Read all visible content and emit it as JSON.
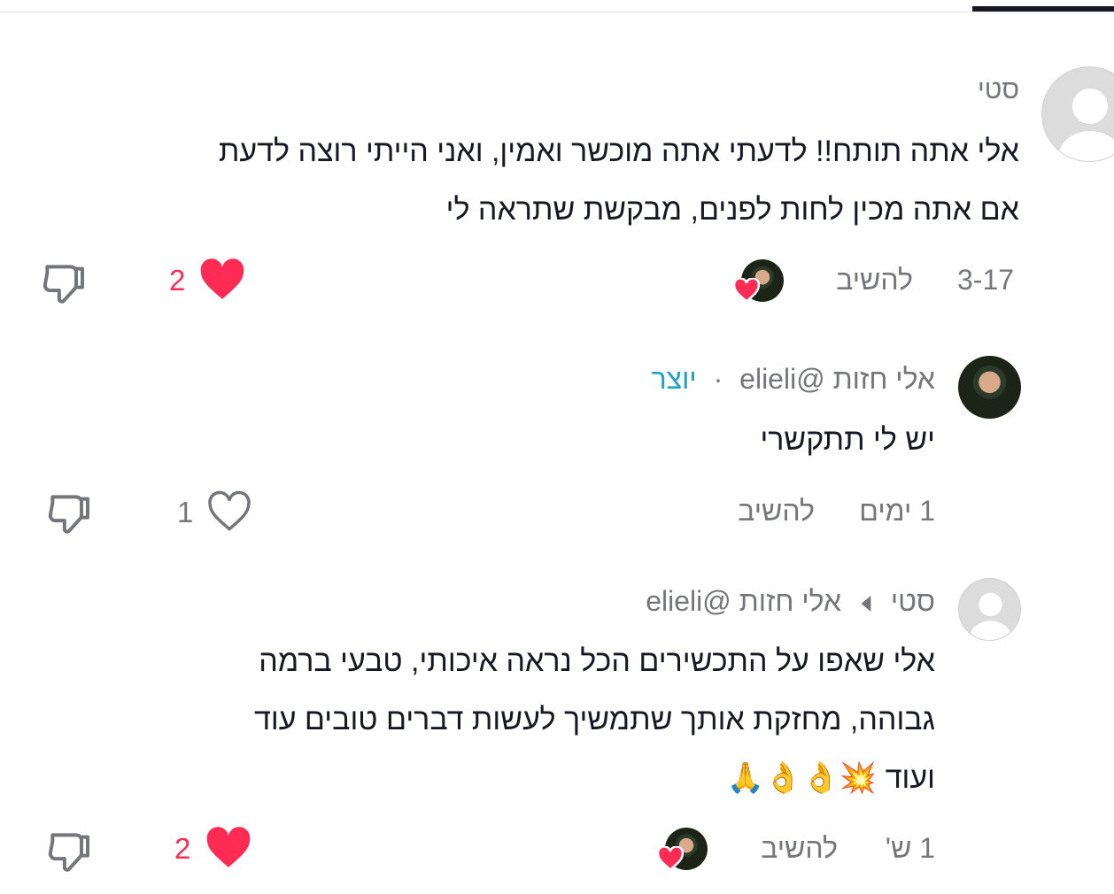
{
  "comments": [
    {
      "author": "סטי",
      "text_line1": "אלי אתה תותח!! לדעתי אתה מוכשר ואמין, ואני הייתי רוצה לדעת",
      "text_line2": "אם אתה מכין לחות לפנים, מבקשת שתראה לי",
      "date": "3-17",
      "reply_label": "להשיב",
      "like_count": "2",
      "liked": true,
      "liked_by_creator": true
    },
    {
      "author": "אלי חזות",
      "handle": "@elieli",
      "separator": "·",
      "badge": "יוצר",
      "text": "יש לי תתקשרי",
      "date": "1 ימים",
      "reply_label": "להשיב",
      "like_count": "1",
      "liked": false
    },
    {
      "author": "סטי",
      "reply_to_name": "אלי חזות",
      "reply_to_handle": "@elieli",
      "text_line1": "אלי שאפו על התכשירים הכל נראה איכותי, טבעי ברמה",
      "text_line2": "גבוהה, מחזקת אותך שתמשיך לעשות דברים טובים עוד",
      "text_line3": "ועוד 💥👌👌🙏",
      "date": "1 ש'",
      "reply_label": "להשיב",
      "like_count": "2",
      "liked": true,
      "liked_by_creator": true
    }
  ],
  "colors": {
    "like_red": "#fe2c55",
    "meta_gray": "#75767b",
    "badge_blue": "#20a0c8"
  }
}
